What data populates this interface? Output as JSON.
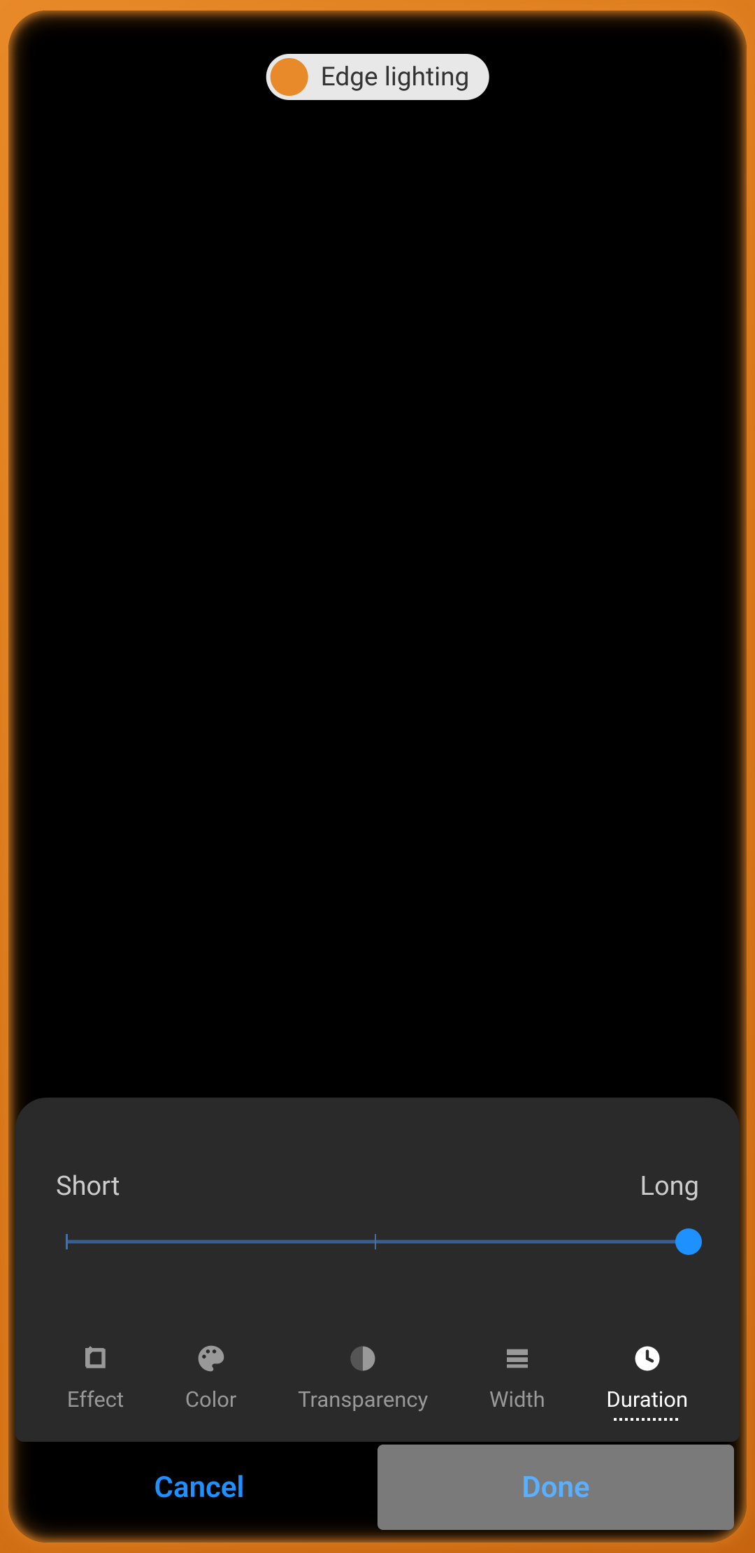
{
  "notification": {
    "label": "Edge lighting",
    "dot_color": "#e88a2a"
  },
  "slider": {
    "min_label": "Short",
    "max_label": "Long",
    "value_percent": 100
  },
  "tabs": [
    {
      "id": "effect",
      "label": "Effect",
      "icon": "effect-icon",
      "active": false
    },
    {
      "id": "color",
      "label": "Color",
      "icon": "palette-icon",
      "active": false
    },
    {
      "id": "transparency",
      "label": "Transparency",
      "icon": "transparency-icon",
      "active": false
    },
    {
      "id": "width",
      "label": "Width",
      "icon": "width-icon",
      "active": false
    },
    {
      "id": "duration",
      "label": "Duration",
      "icon": "clock-icon",
      "active": true
    }
  ],
  "buttons": {
    "cancel": "Cancel",
    "done": "Done"
  },
  "colors": {
    "accent": "#1e90ff",
    "edge_glow": "#e88a2a"
  }
}
